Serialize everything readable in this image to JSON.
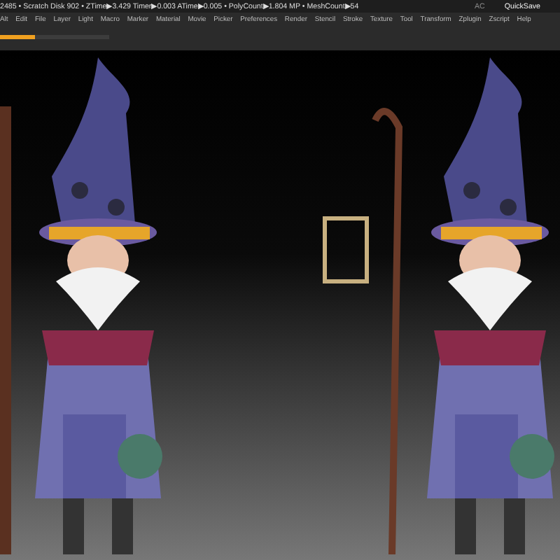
{
  "status_bar": {
    "readout": "2485 • Scratch Disk 902 • ZTime▶3.429 Timer▶0.003 ATime▶0.005 • PolyCount▶1.804 MP • MeshCount▶54",
    "ac": "AC",
    "quicksave": "QuickSave"
  },
  "menu": [
    "Alt",
    "Edit",
    "File",
    "Layer",
    "Light",
    "Macro",
    "Marker",
    "Material",
    "Movie",
    "Picker",
    "Preferences",
    "Render",
    "Stencil",
    "Stroke",
    "Texture",
    "Tool",
    "Transform",
    "Zplugin",
    "Zscript",
    "Help"
  ],
  "progress": {
    "level": 0.32
  }
}
